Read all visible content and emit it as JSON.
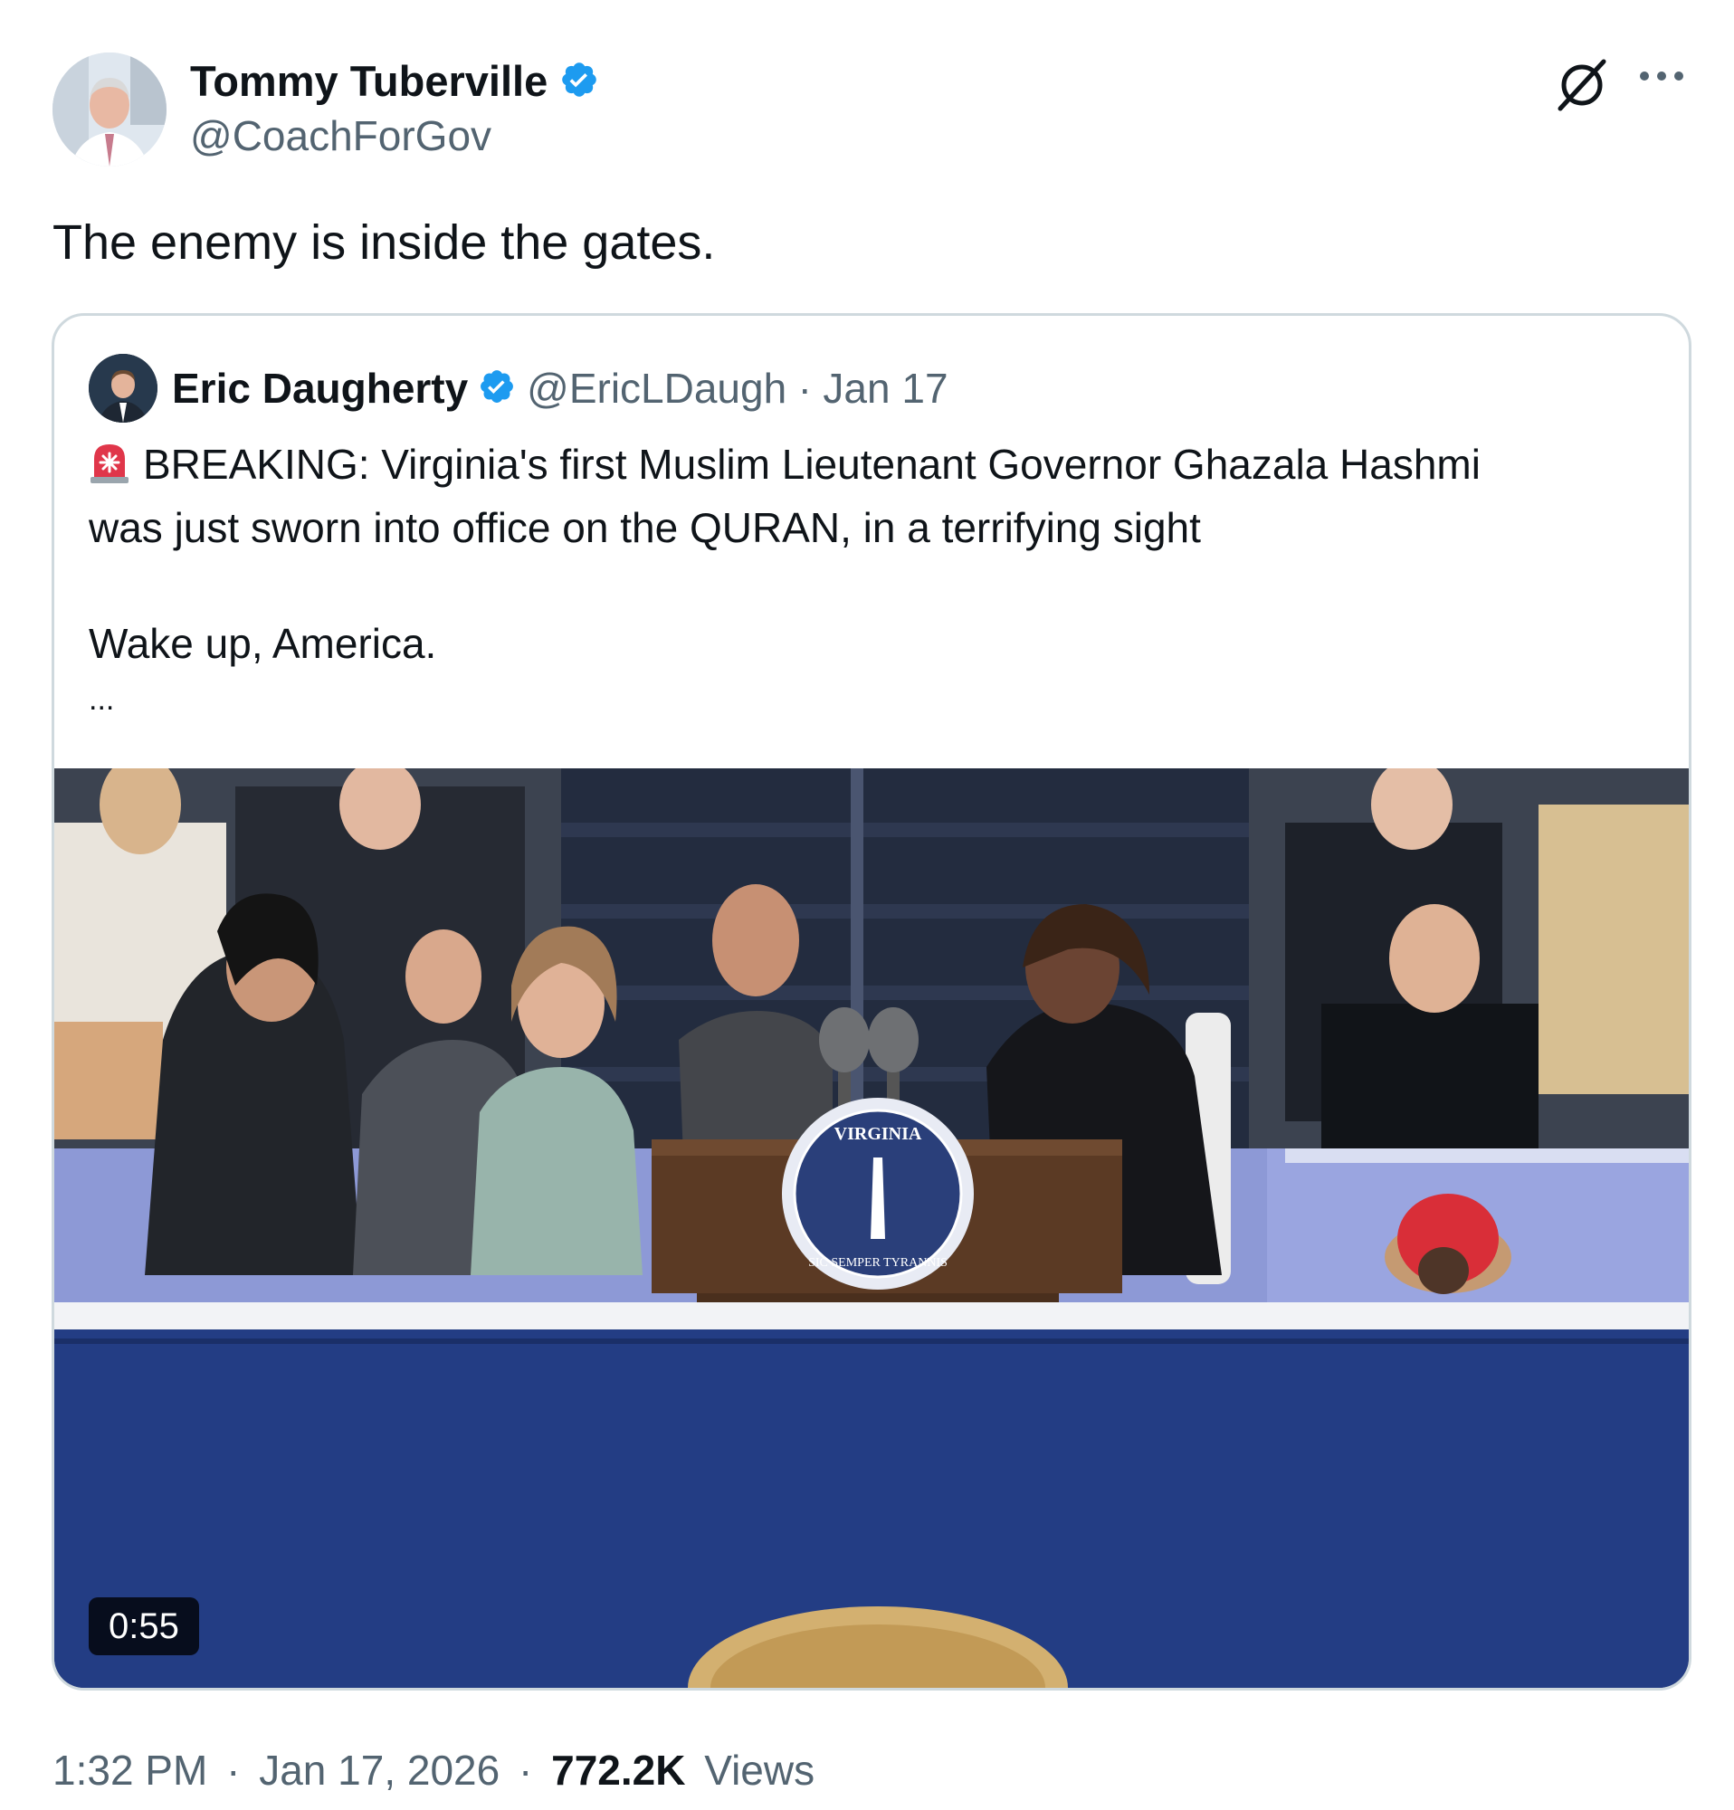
{
  "author": {
    "display_name": "Tommy Tuberville",
    "handle": "@CoachForGov",
    "verified": true
  },
  "header_icons": [
    "grok-icon",
    "more-options-icon"
  ],
  "tweet": {
    "text": "The enemy is inside the gates."
  },
  "quoted_tweet": {
    "display_name": "Eric Daugherty",
    "handle": "@EricLDaugh",
    "dot": "·",
    "date": "Jan 17",
    "verified": true,
    "lines": [
      "BREAKING: Virginia's first Muslim Lieutenant Governor Ghazala Hashmi",
      "was just sworn into office on the QURAN, in a terrifying sight"
    ],
    "line3": "Wake up, America.",
    "truncation": "...",
    "media": {
      "type": "video",
      "duration": "0:55",
      "seal_text": "VIRGINIA",
      "seal_motto": "SIC SEMPER TYRANNIS"
    }
  },
  "meta": {
    "time": "1:32 PM",
    "sep1": "·",
    "date": "Jan 17, 2026",
    "sep2": "·",
    "views_count": "772.2K",
    "views_label": "Views"
  },
  "colors": {
    "verified": "#1d9bf0",
    "secondary_text": "#536471",
    "border": "#cfd9de",
    "stage_blue": "#233d84"
  }
}
